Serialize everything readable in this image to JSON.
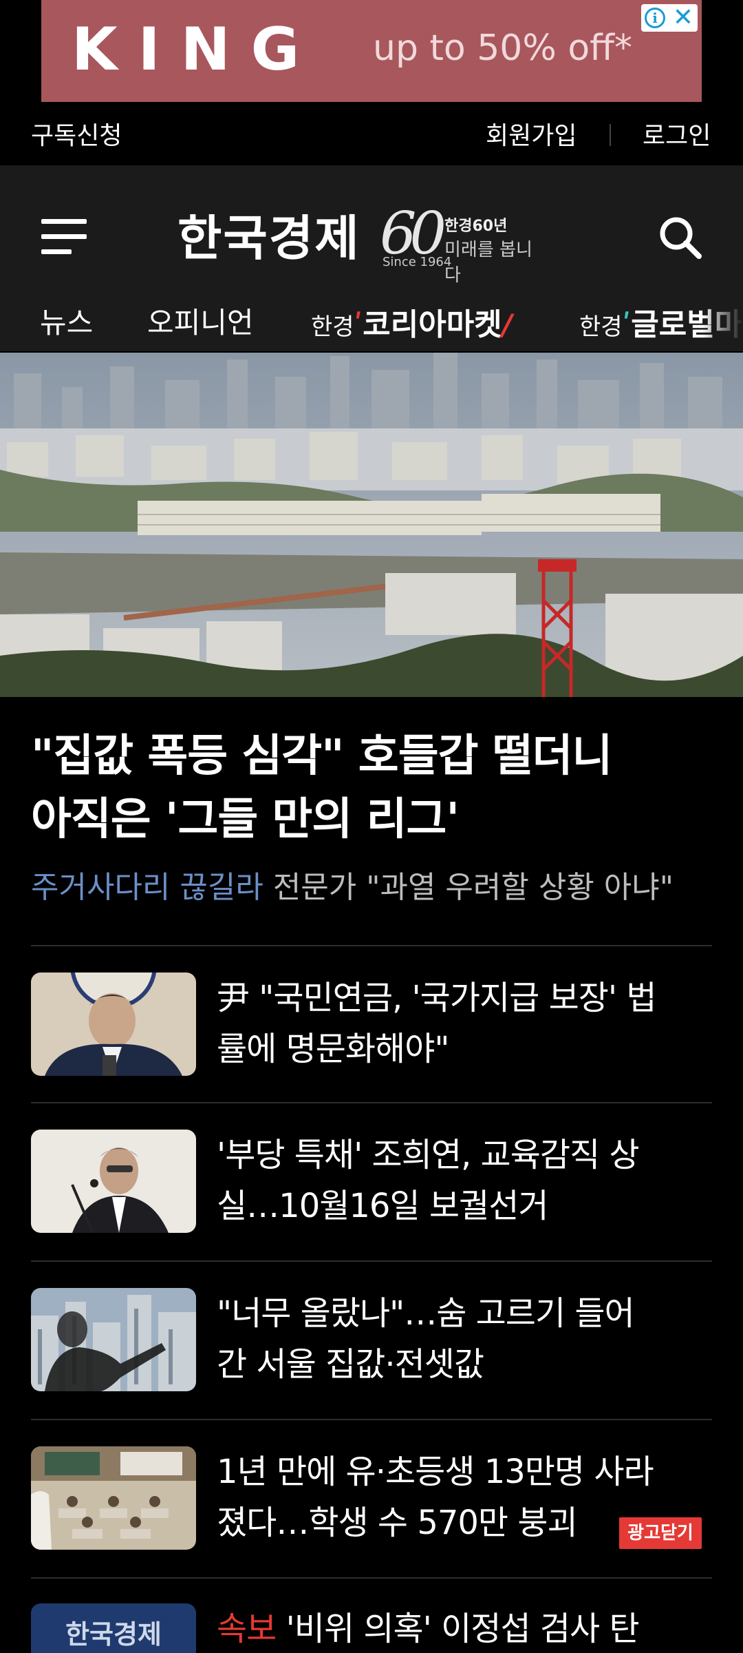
{
  "ad": {
    "brand": "KING",
    "promo": "up to 50% off*",
    "info_glyph": "i",
    "close_glyph": "✕"
  },
  "utility": {
    "subscribe": "구독신청",
    "join": "회원가입",
    "login": "로그인"
  },
  "header": {
    "logo": "한국경제",
    "anniversary_number": "60",
    "anniversary_since": "Since 1964",
    "anniversary_title": "한경60년",
    "anniversary_slogan": "미래를 봅니다",
    "menu_icon": "hamburger-menu-icon",
    "search_icon": "search-icon"
  },
  "nav": {
    "items": [
      {
        "label": "뉴스"
      },
      {
        "label": "오피니언"
      },
      {
        "prefix": "한경",
        "label": "코리아마켓"
      },
      {
        "prefix": "한경",
        "label": "글로벌마켓"
      }
    ]
  },
  "lead": {
    "headline_line1": "\"집값 폭등 심각\" 호들갑 떨더니",
    "headline_line2": "아직은 '그들 만의 리그'",
    "sub_keyword": "주거사다리 끊길라",
    "sub_rest": " 전문가 \"과열 우려할 상황 아냐\""
  },
  "articles": [
    {
      "line1": "尹 \"국민연금, '국가지급 보장' 법",
      "line2": "률에 명문화해야\""
    },
    {
      "line1": "'부당 특채' 조희연, 교육감직 상",
      "line2": "실…10월16일 보궐선거"
    },
    {
      "line1": "\"너무 올랐나\"…숨 고르기 들어",
      "line2": "간 서울 집값·전셋값"
    },
    {
      "line1": "1년 만에 유·초등생 13만명 사라",
      "line2": "졌다…학생 수 570만 붕괴"
    },
    {
      "tag": "속보",
      "line1": " '비위 의혹' 이정섭 검사 탄"
    }
  ],
  "last_thumb_label": "한국경제",
  "ad_close_label": "광고닫기",
  "colors": {
    "accent_red": "#e53935",
    "keyword_blue": "#6c8fc8",
    "header_bg": "#1b1b1b",
    "page_bg": "#000000",
    "ad_bg": "#a8575d"
  }
}
